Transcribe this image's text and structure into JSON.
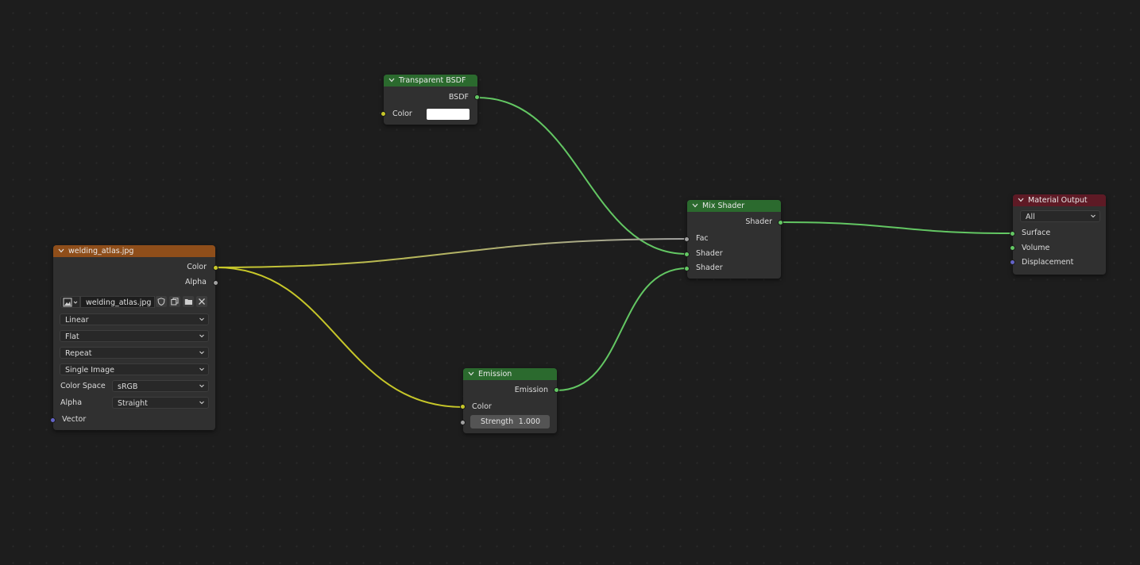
{
  "nodes": {
    "transparent_bsdf": {
      "title": "Transparent BSDF",
      "output": "BSDF",
      "input_color": "Color",
      "color_value": "#ffffff"
    },
    "image_texture": {
      "title": "welding_atlas.jpg",
      "outputs": {
        "color": "Color",
        "alpha": "Alpha"
      },
      "image_name": "welding_atlas.jpg",
      "interpolation": "Linear",
      "projection": "Flat",
      "extension": "Repeat",
      "source": "Single Image",
      "color_space_label": "Color Space",
      "color_space": "sRGB",
      "alpha_label": "Alpha",
      "alpha_mode": "Straight",
      "input_vector": "Vector"
    },
    "mix_shader": {
      "title": "Mix Shader",
      "output": "Shader",
      "inputs": {
        "fac": "Fac",
        "shader1": "Shader",
        "shader2": "Shader"
      }
    },
    "emission": {
      "title": "Emission",
      "output": "Emission",
      "input_color": "Color",
      "strength_label": "Strength",
      "strength_value": "1.000"
    },
    "material_output": {
      "title": "Material Output",
      "target": "All",
      "inputs": {
        "surface": "Surface",
        "volume": "Volume",
        "displacement": "Displacement"
      }
    }
  },
  "colors": {
    "editor_bg": "#1d1d1d",
    "node_bg": "#303030",
    "shader_header": "#2b6a2e",
    "texture_header": "#8f4e1a",
    "output_header": "#5e1a25",
    "socket_shader": "#63c763",
    "socket_color": "#c7c729",
    "socket_float": "#a1a1a1",
    "socket_vector": "#6363c7"
  }
}
